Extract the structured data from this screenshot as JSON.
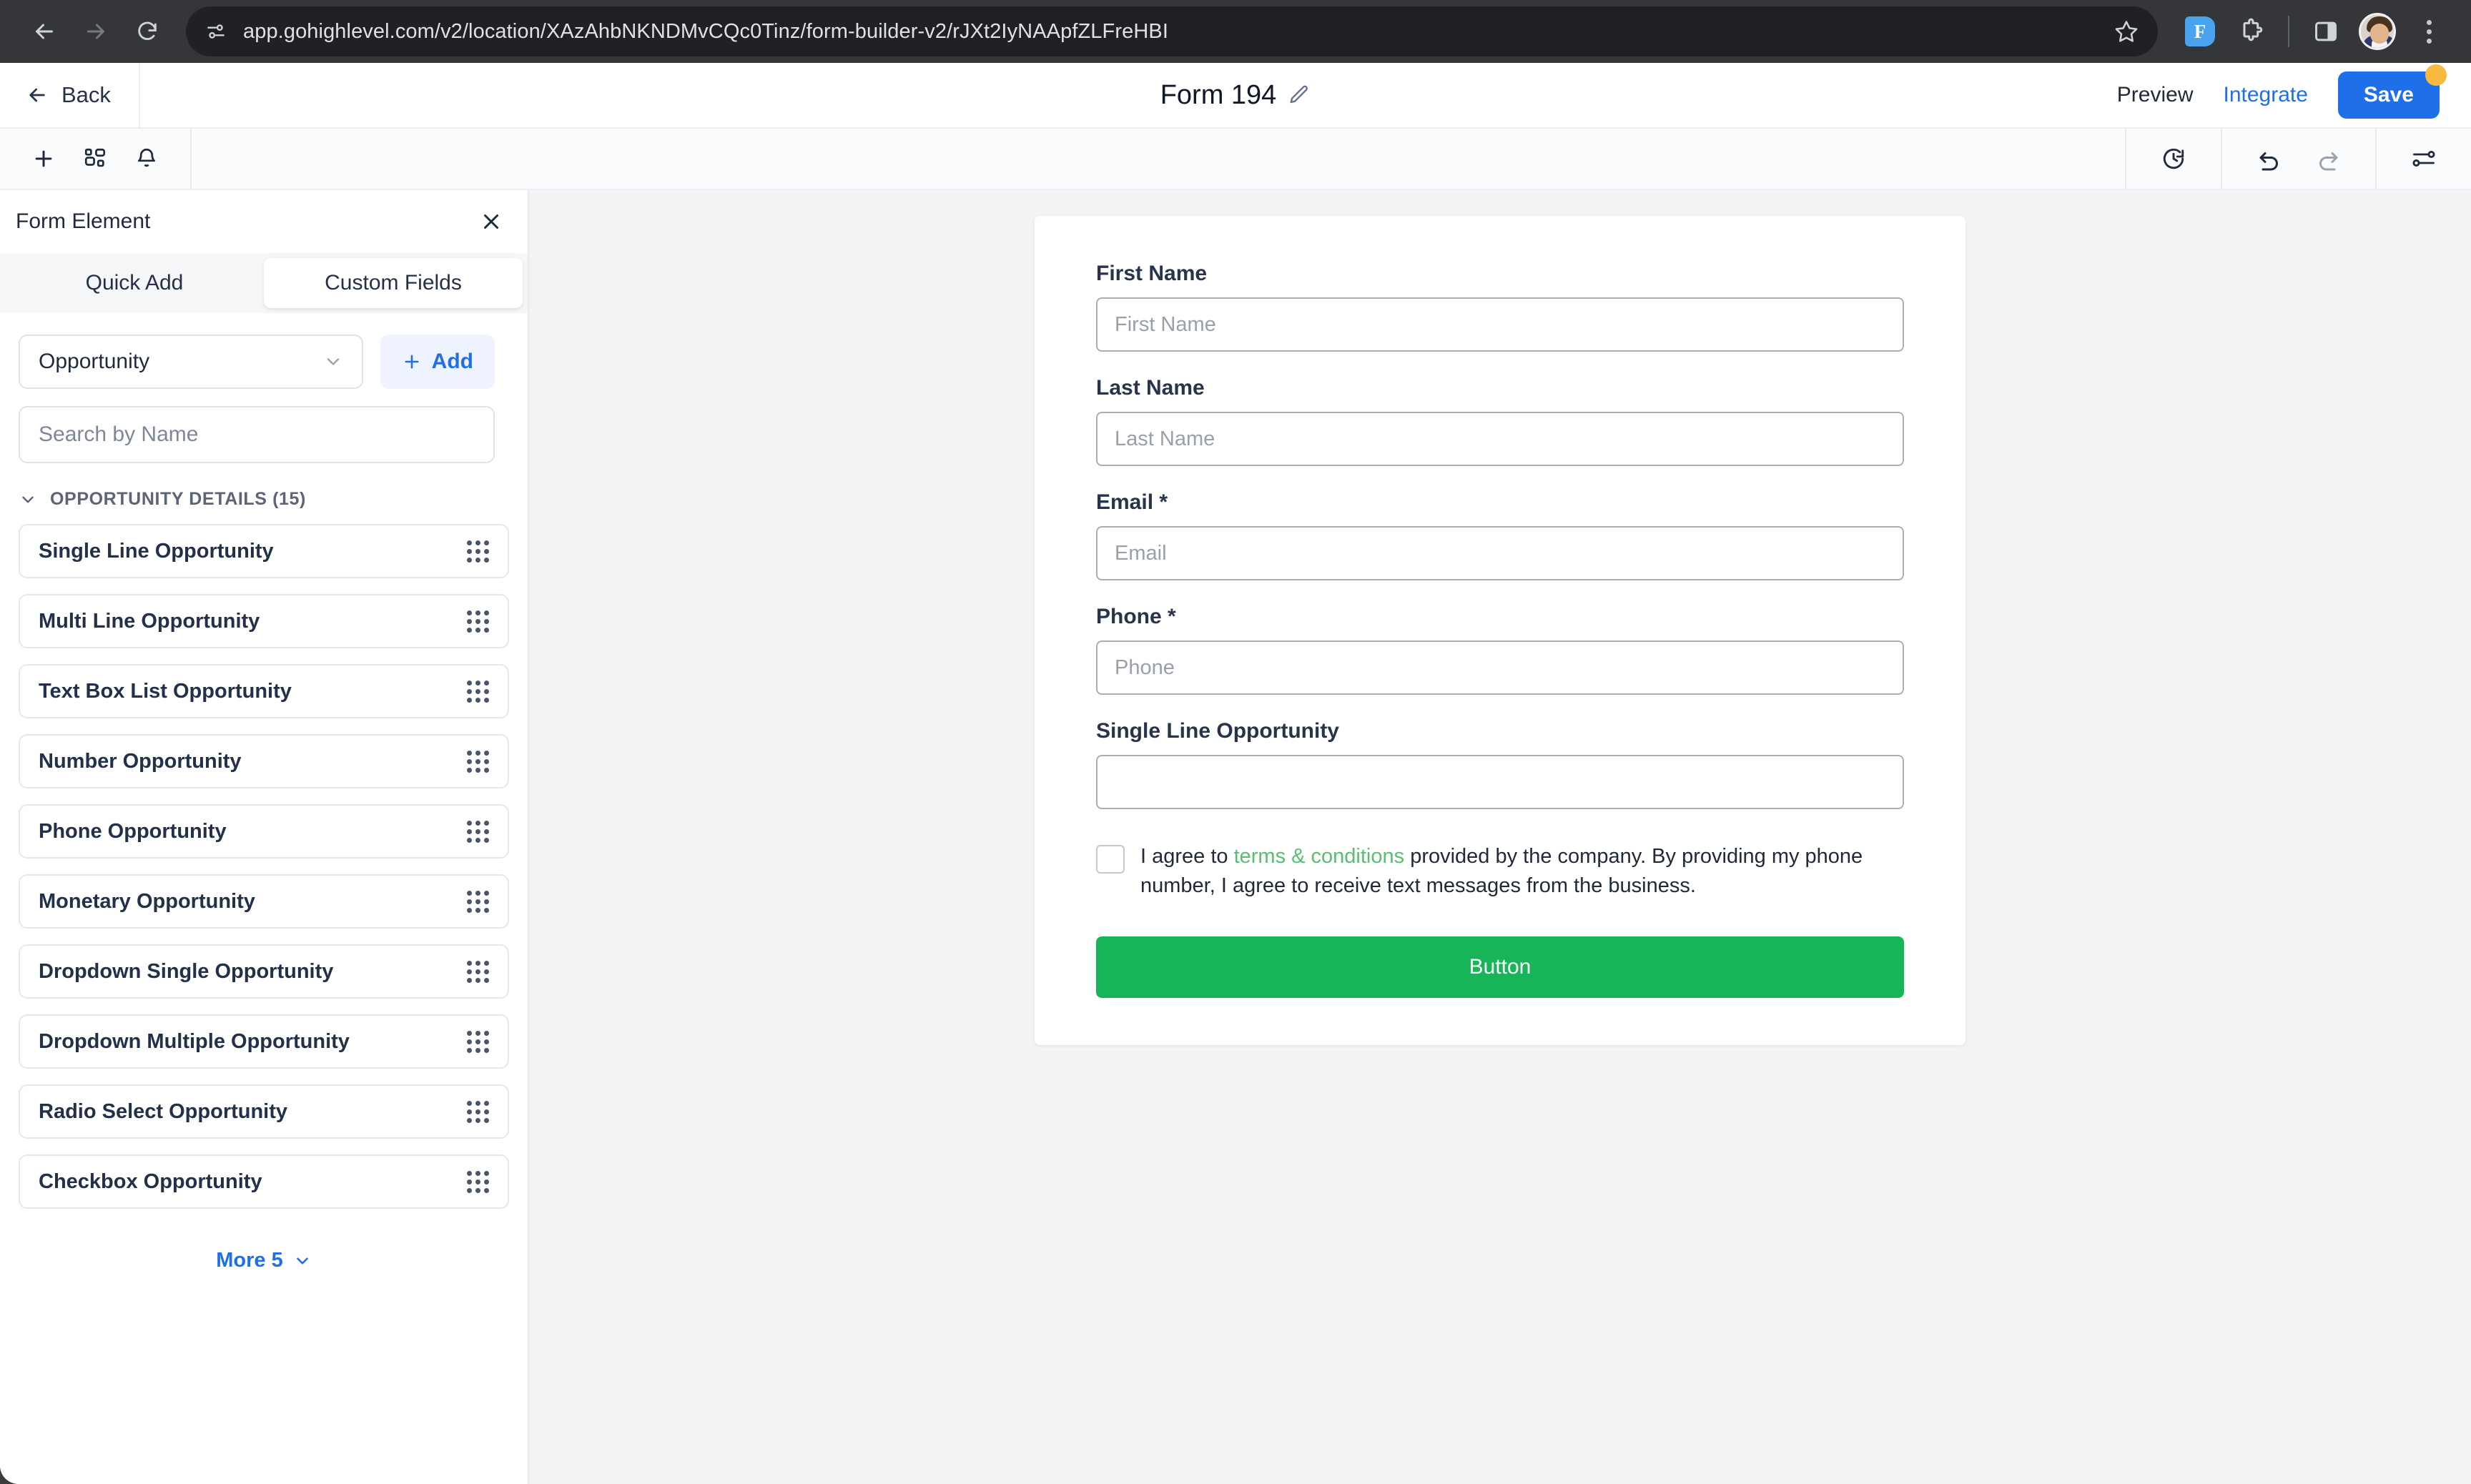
{
  "browser": {
    "url": "app.gohighlevel.com/v2/location/XAzAhbNKNDMvCQc0Tinz/form-builder-v2/rJXt2IyNAApfZLFreHBI",
    "back_icon": "arrow-left-icon",
    "forward_icon": "arrow-right-icon",
    "reload_icon": "reload-icon",
    "site_info_icon": "page-settings-icon",
    "bookmark_icon": "star-icon",
    "extension_f_label": "F",
    "extensions_icon": "puzzle-piece-icon",
    "side_panel_icon": "side-panel-icon",
    "profile_icon": "avatar-icon",
    "menu_icon": "kebab-menu-icon"
  },
  "header": {
    "back_label": "Back",
    "form_title": "Form 194",
    "edit_title_icon": "pencil-icon",
    "preview_label": "Preview",
    "integrate_label": "Integrate",
    "save_label": "Save",
    "save_badge": "unsaved-changes-dot"
  },
  "toolbar": {
    "add_icon": "plus-icon",
    "layout_icon": "nodes-layout-icon",
    "notification_icon": "bell-icon",
    "history_icon": "clock-history-icon",
    "undo_icon": "undo-icon",
    "redo_icon": "redo-icon",
    "settings_icon": "sliders-settings-icon"
  },
  "sidebar": {
    "panel_title": "Form Element",
    "close_icon": "close-icon",
    "tabs": [
      {
        "label": "Quick Add",
        "active": false
      },
      {
        "label": "Custom Fields",
        "active": true
      }
    ],
    "object_select": {
      "value": "Opportunity",
      "chevron_icon": "chevron-down-icon"
    },
    "add_button": {
      "label": "Add",
      "icon": "plus-icon"
    },
    "search": {
      "value": "",
      "placeholder": "Search by Name"
    },
    "section": {
      "label": "OPPORTUNITY DETAILS (15)",
      "chevron_icon": "chevron-down-icon"
    },
    "fields": [
      {
        "label": "Single Line Opportunity"
      },
      {
        "label": "Multi Line Opportunity"
      },
      {
        "label": "Text Box List Opportunity"
      },
      {
        "label": "Number Opportunity"
      },
      {
        "label": "Phone Opportunity"
      },
      {
        "label": "Monetary Opportunity"
      },
      {
        "label": "Dropdown Single Opportunity"
      },
      {
        "label": "Dropdown Multiple Opportunity"
      },
      {
        "label": "Radio Select Opportunity"
      },
      {
        "label": "Checkbox Opportunity"
      }
    ],
    "more": {
      "label": "More 5",
      "chevron_icon": "chevron-down-icon"
    }
  },
  "form": {
    "fields": [
      {
        "label": "First Name",
        "placeholder": "First Name",
        "value": ""
      },
      {
        "label": "Last Name",
        "placeholder": "Last Name",
        "value": ""
      },
      {
        "label": "Email *",
        "placeholder": "Email",
        "value": ""
      },
      {
        "label": "Phone *",
        "placeholder": "Phone",
        "value": ""
      },
      {
        "label": "Single Line Opportunity",
        "placeholder": "",
        "value": ""
      }
    ],
    "consent": {
      "prefix": "I agree to ",
      "link": "terms & conditions",
      "suffix": " provided by the company. By providing my phone number, I agree to receive text messages from the business.",
      "checked": false
    },
    "submit_label": "Button"
  },
  "colors": {
    "primary_blue": "#1f6feb",
    "submit_green": "#18b558",
    "terms_green": "#5bbd72",
    "badge_orange": "#f7b93e",
    "canvas_gray": "#f1f3f5"
  }
}
